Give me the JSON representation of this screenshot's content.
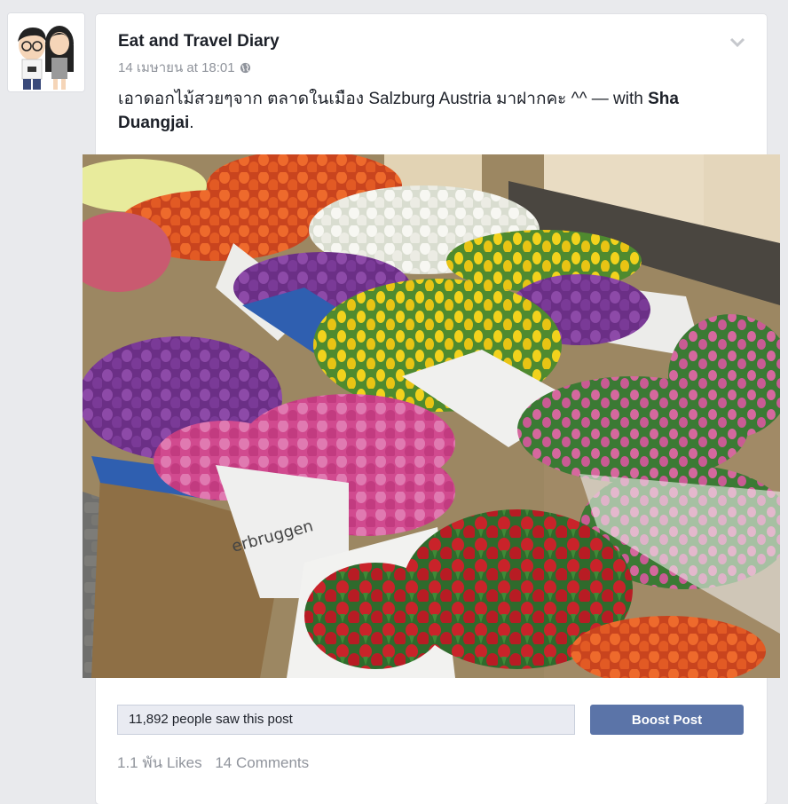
{
  "post": {
    "author": "Eat and Travel Diary",
    "timestamp": "14 เมษายน at 18:01",
    "privacy_icon": "globe-icon",
    "text_prefix": "เอาดอกไม้สวยๆจาก ตลาดในเมือง Salzburg Austria มาฝากคะ ^^ — with ",
    "tagged_name": "Sha Duangjai",
    "text_suffix": ".",
    "menu_icon": "chevron-down-icon",
    "photo_sign_text": "erbruggen"
  },
  "insights": {
    "reach_text": "11,892 people saw this post",
    "boost_label": "Boost Post"
  },
  "engagement": {
    "likes": "1.1 พัน Likes",
    "comments": "14 Comments"
  },
  "colors": {
    "accent": "#5b74a8",
    "muted_text": "#90949c",
    "background": "#e9eaed"
  }
}
